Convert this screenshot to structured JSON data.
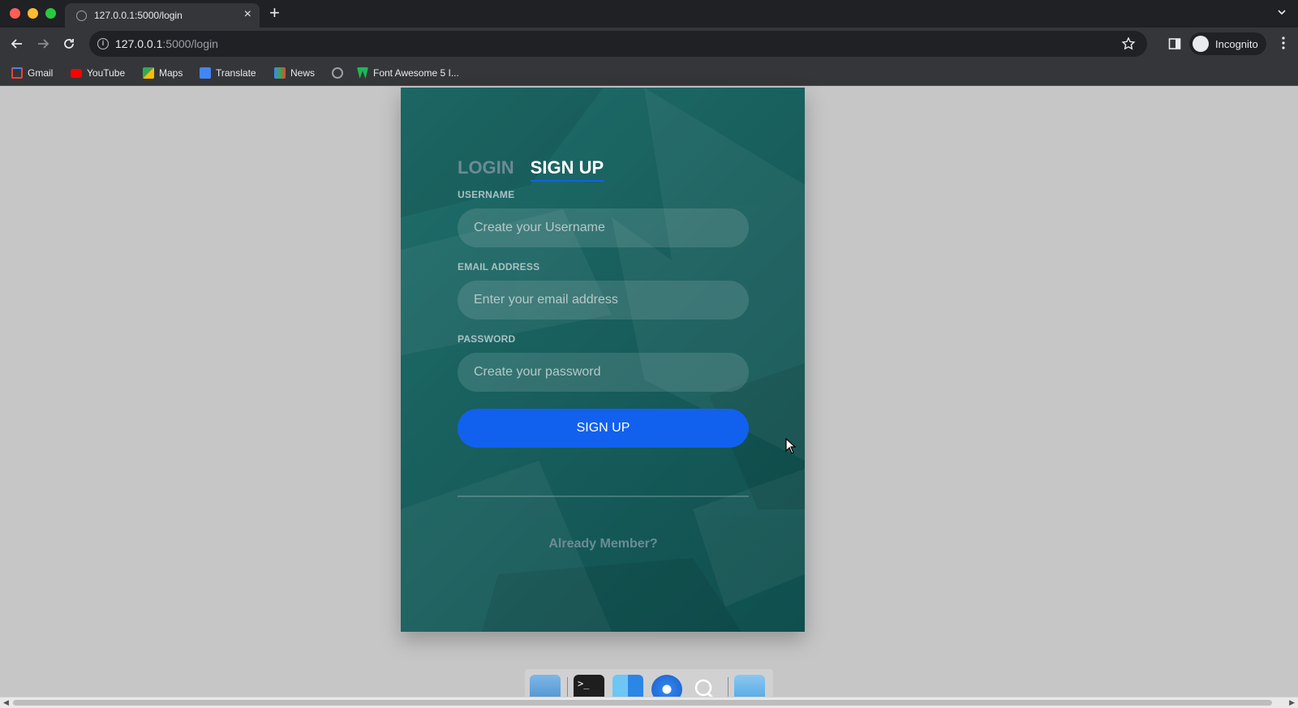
{
  "browser": {
    "tab_title": "127.0.0.1:5000/login",
    "url_host": "127.0.0.1",
    "url_path": ":5000/login",
    "incognito_label": "Incognito",
    "bookmarks": [
      {
        "label": "Gmail",
        "icon": "gmail-icon",
        "color": "#ea4335"
      },
      {
        "label": "YouTube",
        "icon": "youtube-icon",
        "color": "#ff0000"
      },
      {
        "label": "Maps",
        "icon": "maps-icon",
        "color": "#34a853"
      },
      {
        "label": "Translate",
        "icon": "translate-icon",
        "color": "#4285f4"
      },
      {
        "label": "News",
        "icon": "news-icon",
        "color": "#4285f4"
      },
      {
        "label": "",
        "icon": "globe-icon",
        "color": "#9aa0a6"
      },
      {
        "label": "Font Awesome 5 I...",
        "icon": "font-awesome-icon",
        "color": "#1db954"
      }
    ]
  },
  "form": {
    "tab_login": "LOGIN",
    "tab_signup": "SIGN UP",
    "username_label": "USERNAME",
    "username_placeholder": "Create your Username",
    "email_label": "EMAIL ADDRESS",
    "email_placeholder": "Enter your email address",
    "password_label": "PASSWORD",
    "password_placeholder": "Create your password",
    "submit_label": "SIGN UP",
    "already_member": "Already Member?"
  },
  "colors": {
    "accent": "#1161ee",
    "card": "#185f5d",
    "page_bg": "#c6c6c6"
  },
  "dock": {
    "items": [
      "files-icon",
      "terminal-icon",
      "finder-icon",
      "safari-icon",
      "search-icon",
      "folder-icon"
    ]
  }
}
